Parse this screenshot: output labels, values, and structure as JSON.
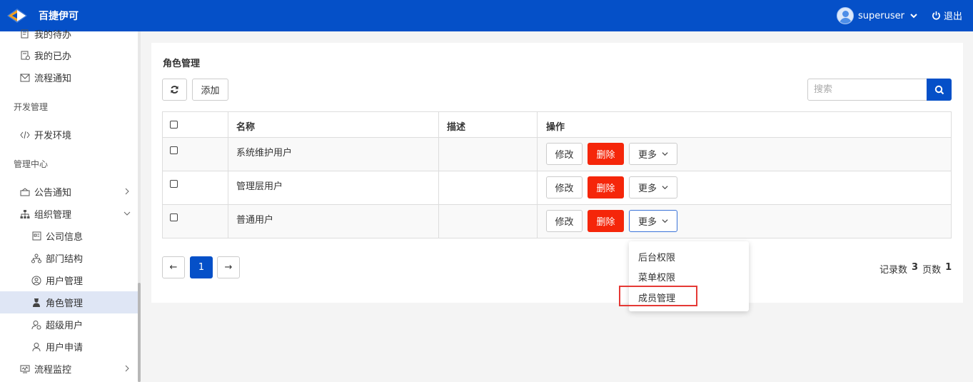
{
  "header": {
    "app_title": "百捷伊可",
    "username": "superuser",
    "logout_label": "退出"
  },
  "sidebar": {
    "items": [
      {
        "label": "我的待办",
        "icon": "todo-icon"
      },
      {
        "label": "我的已办",
        "icon": "done-icon"
      },
      {
        "label": "流程通知",
        "icon": "mail-icon"
      },
      {
        "group": "开发管理"
      },
      {
        "label": "开发环境",
        "icon": "code-icon"
      },
      {
        "group": "管理中心"
      },
      {
        "label": "公告通知",
        "icon": "notice-icon",
        "arrow": "right"
      },
      {
        "label": "组织管理",
        "icon": "org-icon",
        "arrow": "down"
      },
      {
        "label": "公司信息",
        "icon": "company-icon"
      },
      {
        "label": "部门结构",
        "icon": "dept-icon"
      },
      {
        "label": "用户管理",
        "icon": "user-circle-icon"
      },
      {
        "label": "角色管理",
        "icon": "role-icon",
        "active": true
      },
      {
        "label": "超级用户",
        "icon": "super-user-icon"
      },
      {
        "label": "用户申请",
        "icon": "user-apply-icon"
      },
      {
        "label": "流程监控",
        "icon": "monitor-icon",
        "arrow": "right"
      }
    ]
  },
  "main": {
    "title": "角色管理",
    "refresh_icon": "refresh-icon",
    "add_label": "添加",
    "search_placeholder": "搜索",
    "table": {
      "headers": [
        "名称",
        "描述",
        "操作"
      ],
      "rows": [
        {
          "name": "系统维护用户",
          "desc": ""
        },
        {
          "name": "管理层用户",
          "desc": ""
        },
        {
          "name": "普通用户",
          "desc": ""
        }
      ],
      "actions": {
        "edit": "修改",
        "delete": "删除",
        "more": "更多"
      }
    },
    "dropdown": [
      "后台权限",
      "菜单权限",
      "成员管理"
    ],
    "pagination": {
      "prev": "←",
      "current": "1",
      "next": "→"
    },
    "stats": {
      "records_label": "记录数",
      "records": "3",
      "pages_label": "页数",
      "pages": "1"
    }
  },
  "colors": {
    "primary": "#0550c8",
    "danger": "#f5260a",
    "highlight": "#e53935"
  }
}
